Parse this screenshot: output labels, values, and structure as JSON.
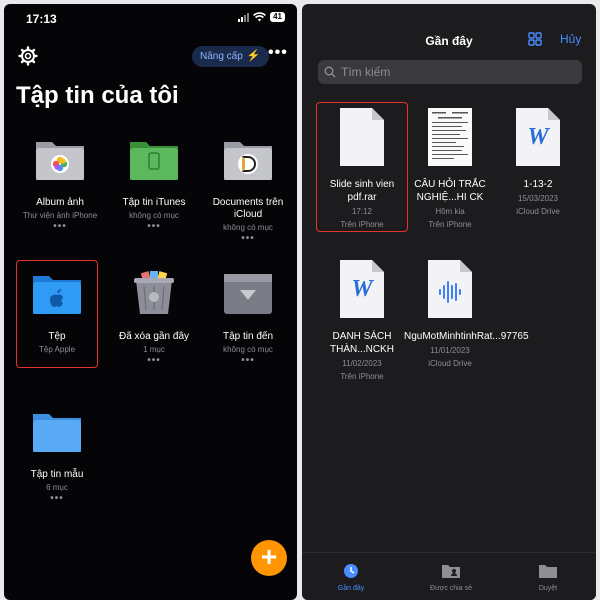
{
  "left": {
    "status": {
      "time": "17:13",
      "battery": "41"
    },
    "upgrade_label": "Nâng cấp",
    "more_label": "•••",
    "title": "Tập tin của tôi",
    "tiles": [
      {
        "title": "Album ảnh",
        "sub": "Thư viện ảnh iPhone",
        "dots": "•••"
      },
      {
        "title": "Tập tin iTunes",
        "sub": "không có mục",
        "dots": "•••"
      },
      {
        "title": "Documents trên iCloud",
        "sub": "không có mục",
        "dots": "•••"
      },
      {
        "title": "Tệp",
        "sub": "Tệp Apple",
        "dots": ""
      },
      {
        "title": "Đã xóa gần đây",
        "sub": "1 mục",
        "dots": "•••"
      },
      {
        "title": "Tập tin đến",
        "sub": "không có mục",
        "dots": "•••"
      },
      {
        "title": "Tập tin mẫu",
        "sub": "6 mục",
        "dots": "•••"
      }
    ],
    "fab_label": "+"
  },
  "right": {
    "title": "Gần đây",
    "cancel_label": "Hủy",
    "search_placeholder": "Tìm kiếm",
    "files": [
      {
        "name": "Slide sinh vien pdf.rar",
        "date": "17:12",
        "location": "Trên iPhone"
      },
      {
        "name": "CÂU HỎI TRẮC NGHIỆ...HI CK",
        "date": "Hôm kia",
        "location": "Trên iPhone"
      },
      {
        "name": "1-13-2",
        "date": "15/03/2023",
        "location": "iCloud Drive"
      },
      {
        "name": "DANH SÁCH THÀN...NCKH",
        "date": "11/02/2023",
        "location": "Trên iPhone"
      },
      {
        "name": "NguMotMinhtinhRat...97765",
        "date": "11/01/2023",
        "location": "iCloud Drive"
      }
    ],
    "tabs": [
      {
        "label": "Gần đây"
      },
      {
        "label": "Được chia sẻ"
      },
      {
        "label": "Duyệt"
      }
    ]
  },
  "colors": {
    "accent": "#4a8dff",
    "highlight": "#e5332a",
    "fab": "#ff9500"
  }
}
